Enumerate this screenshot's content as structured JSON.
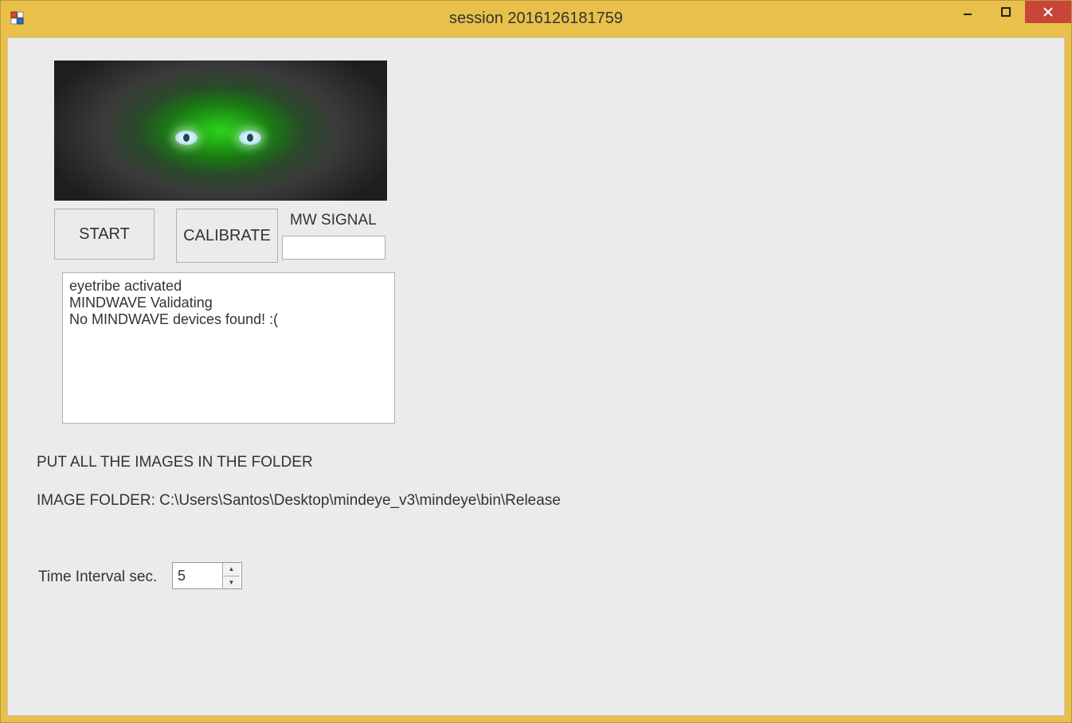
{
  "titlebar": {
    "title": "session 2016126181759"
  },
  "controls": {
    "start_label": "START",
    "calibrate_label": "CALIBRATE",
    "mw_signal_label": "MW SIGNAL",
    "mw_signal_value": ""
  },
  "log": {
    "text": "eyetribe activated\nMINDWAVE Validating\nNo MINDWAVE devices found! :("
  },
  "instructions": {
    "line1": "PUT ALL THE IMAGES IN THE FOLDER",
    "line2": "IMAGE FOLDER: C:\\Users\\Santos\\Desktop\\mindeye_v3\\mindeye\\bin\\Release"
  },
  "interval": {
    "label": "Time Interval sec.",
    "value": "5"
  }
}
